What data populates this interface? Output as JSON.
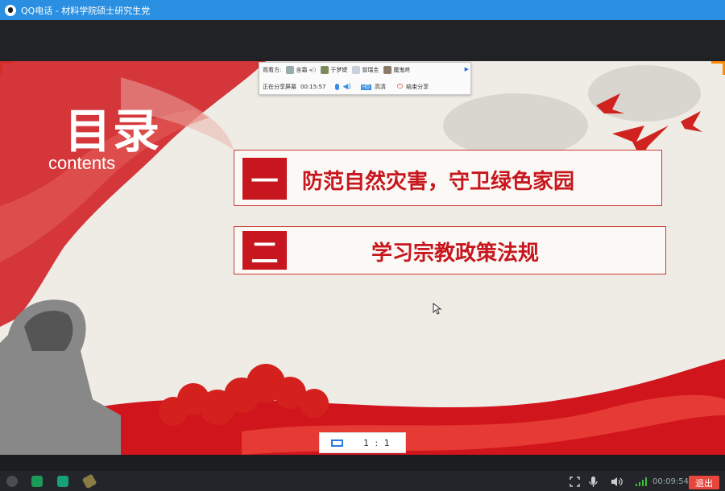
{
  "window": {
    "title": "QQ电话 - 材料学院硕士研究生党"
  },
  "share_toolbar": {
    "viewers_label": "观看方:",
    "viewers": [
      "含霜",
      "于梦婕",
      "曾瑞圭",
      "魔鬼咚"
    ],
    "status_text": "正在分享屏幕",
    "elapsed": "00:15:57",
    "quality_label": "高清",
    "end_label": "结束分享"
  },
  "slide": {
    "heading": "目录",
    "subheading": "contents",
    "items": [
      {
        "num": "一",
        "text": "防范自然灾害，守卫绿色家园"
      },
      {
        "num": "二",
        "text": "学习宗教政策法规"
      }
    ]
  },
  "zoom": {
    "ratio": "1 : 1"
  },
  "bottom_bar": {
    "call_time": "00:09:54",
    "exit_label": "退出"
  },
  "colors": {
    "titlebar": "#2a8fe0",
    "accent_red": "#c7161d",
    "exit_button": "#e8453c"
  }
}
